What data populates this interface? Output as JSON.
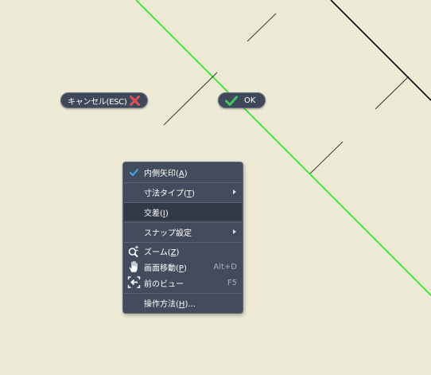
{
  "canvas": {
    "background": "#ecead5",
    "accent_line_color": "#22e61c",
    "line_color": "#000000"
  },
  "cancel_button": {
    "label": "キャンセル(ESC)",
    "icon": "close-x-icon",
    "icon_color": "#e0505a"
  },
  "ok_button": {
    "label": "OK",
    "icon": "checkmark-icon",
    "icon_color": "#43c463"
  },
  "menu": {
    "items": [
      {
        "label": "内側矢印",
        "key": "A",
        "checked": true,
        "icon": "checkmark-icon"
      },
      {
        "label": "寸法タイプ",
        "key": "T",
        "submenu": true,
        "icon": "chevron-right-icon"
      },
      {
        "label": "交差",
        "key": "I",
        "highlighted": true
      },
      {
        "label": "スナップ設定",
        "submenu": true,
        "icon": "chevron-right-icon"
      },
      {
        "label": "ズーム",
        "key": "Z",
        "icon": "zoom-icon"
      },
      {
        "label": "画面移動",
        "key": "P",
        "shortcut": "Alt+D",
        "icon": "pan-hand-icon"
      },
      {
        "label": "前のビュー",
        "shortcut": "F5",
        "icon": "previous-view-icon"
      },
      {
        "label": "操作方法",
        "key": "H",
        "suffix": "..."
      }
    ]
  }
}
